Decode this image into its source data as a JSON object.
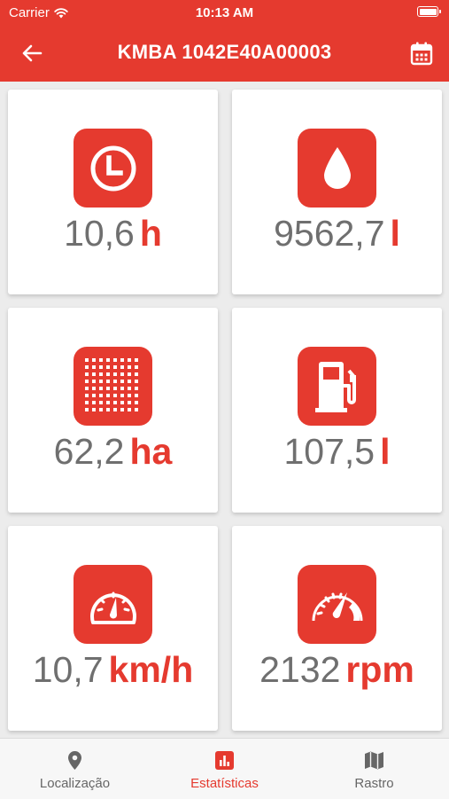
{
  "status_bar": {
    "carrier": "Carrier",
    "time": "10:13 AM"
  },
  "header": {
    "title": "KMBA 1042E40A00003",
    "back_icon": "arrow-left-icon",
    "calendar_icon": "calendar-icon"
  },
  "stats": [
    {
      "icon": "clock-icon",
      "value": "10,6",
      "unit": "h"
    },
    {
      "icon": "drop-icon",
      "value": "9562,7",
      "unit": "l"
    },
    {
      "icon": "grid-dots-icon",
      "value": "62,2",
      "unit": "ha"
    },
    {
      "icon": "fuel-pump-icon",
      "value": "107,5",
      "unit": "l"
    },
    {
      "icon": "speedometer-icon",
      "value": "10,7",
      "unit": "km/h"
    },
    {
      "icon": "tachometer-icon",
      "value": "2132",
      "unit": "rpm"
    }
  ],
  "tabs": [
    {
      "label": "Localização",
      "icon": "location-pin-icon",
      "active": false
    },
    {
      "label": "Estatísticas",
      "icon": "bar-chart-icon",
      "active": true
    },
    {
      "label": "Rastro",
      "icon": "map-icon",
      "active": false
    }
  ],
  "colors": {
    "accent": "#e53a2f",
    "value_text": "#6f6f6f",
    "background": "#ececec"
  }
}
